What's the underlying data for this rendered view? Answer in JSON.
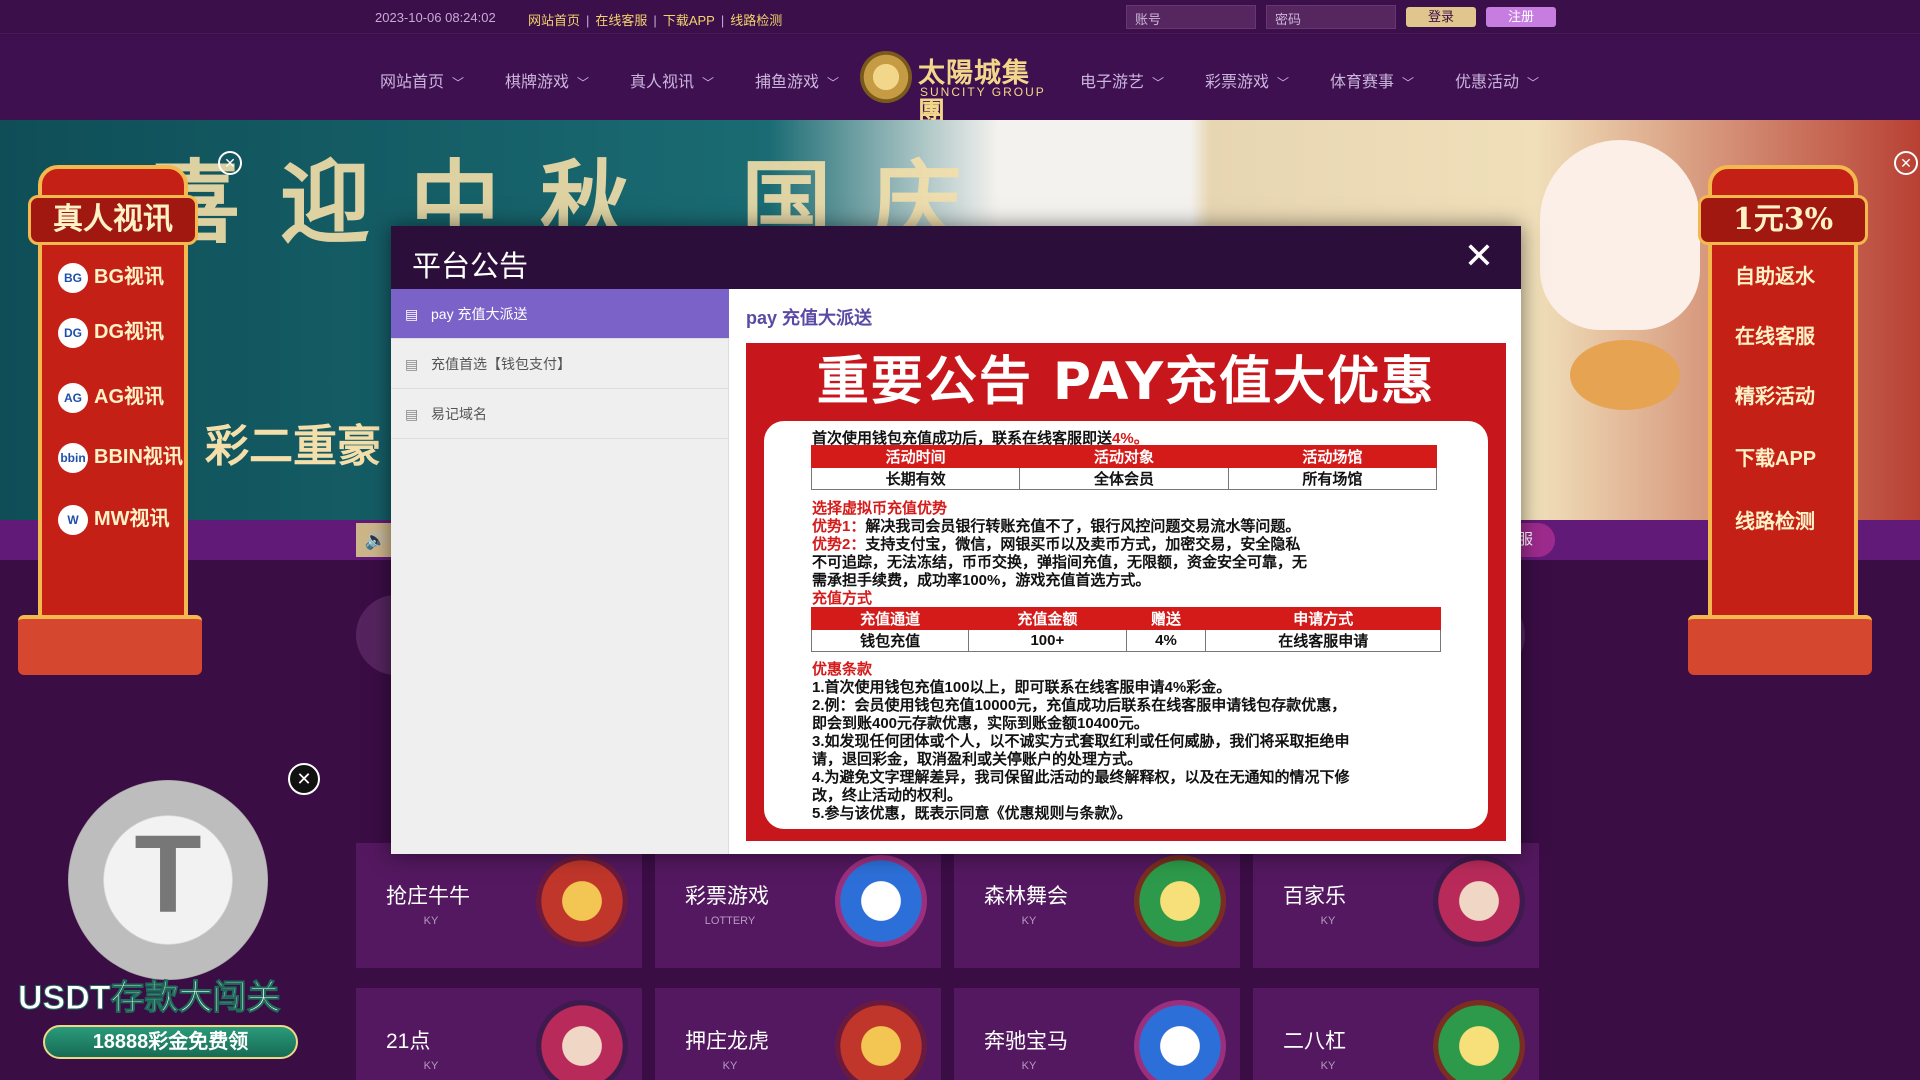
{
  "topbar": {
    "datetime": "2023-10-06 08:24:02",
    "links": [
      "网站首页",
      "在线客服",
      "下载APP",
      "线路检测"
    ],
    "account_placeholder": "账号",
    "password_placeholder": "密码",
    "login_label": "登录",
    "register_label": "注册"
  },
  "nav": {
    "left": [
      "网站首页",
      "棋牌游戏",
      "真人视讯",
      "捕鱼游戏"
    ],
    "right": [
      "电子游艺",
      "彩票游戏",
      "体育赛事",
      "优惠活动"
    ],
    "logo_cn": "太陽城集團",
    "logo_en": "SUNCITY GROUP"
  },
  "banner": {
    "title": "喜迎中秋 国庆",
    "subtitle": "彩二重豪"
  },
  "strip": {
    "service_tail": "服"
  },
  "left_float": {
    "header": "真人视讯",
    "items": [
      {
        "badge": "BG",
        "label": "BG视讯"
      },
      {
        "badge": "DG",
        "label": "DG视讯"
      },
      {
        "badge": "AG",
        "label": "AG视讯"
      },
      {
        "badge": "bbin",
        "label": "BBIN视讯"
      },
      {
        "badge": "W",
        "label": "MW视讯"
      }
    ]
  },
  "right_float": {
    "header": "1元3%",
    "items": [
      "自助返水",
      "在线客服",
      "精彩活动",
      "下载APP",
      "线路检测"
    ]
  },
  "usdt_promo": {
    "coin_text": "TETHER",
    "title": "USDT存款大闯关",
    "subtitle": "18888彩金免费领"
  },
  "games": [
    {
      "name": "抢庄牛牛",
      "tag": "KY",
      "icon": "抢庄牛牛"
    },
    {
      "name": "彩票游戏",
      "tag": "LOTTERY",
      "icon": "彩票游戏"
    },
    {
      "name": "森林舞会",
      "tag": "KY",
      "icon": "森林舞会"
    },
    {
      "name": "百家乐",
      "tag": "KY",
      "icon": "百家乐"
    },
    {
      "name": "21点",
      "tag": "KY",
      "icon": "21点"
    },
    {
      "name": "押庄龙虎",
      "tag": "KY",
      "icon": "押庄龙虎"
    },
    {
      "name": "奔驰宝马",
      "tag": "KY",
      "icon": "奔驰宝马"
    },
    {
      "name": "二八杠",
      "tag": "KY",
      "icon": "二八杠"
    }
  ],
  "modal": {
    "title": "平台公告",
    "close_icon": "close-icon",
    "list": [
      "pay 充值大派送",
      "充值首选【钱包支付】",
      "易记域名"
    ],
    "active_index": 0,
    "content_title": "pay 充值大派送",
    "poster": {
      "headline": "重要公告 PAY充值大优惠",
      "intro_prefix": "首次使用钱包充值成功后，联系在线客服即送",
      "intro_pct": "4%。",
      "table1": {
        "headers": [
          "活动时间",
          "活动对象",
          "活动场馆"
        ],
        "row": [
          "长期有效",
          "全体会员",
          "所有场馆"
        ]
      },
      "adv_title": "选择虚拟币充值优势",
      "adv1_label": "优势1：",
      "adv1": "解决我司会员银行转账充值不了，银行风控问题交易流水等问题。",
      "adv2_label": "优势2：",
      "adv2a": "支持支付宝，微信，网银买币以及卖币方式，加密交易，安全隐私",
      "adv2b": "不可追踪，无法冻结，币币交换，弹指间充值，无限额，资金安全可靠，无",
      "adv2c": "需承担手续费，成功率100%，游戏充值首选方式。",
      "method_title": "充值方式",
      "table2": {
        "headers": [
          "充值通道",
          "充值金额",
          "赠送",
          "申请方式"
        ],
        "row": [
          "钱包充值",
          "100+",
          "4%",
          "在线客服申请"
        ]
      },
      "terms_title": "优惠条款",
      "terms": [
        "1.首次使用钱包充值100以上，即可联系在线客服申请4%彩金。",
        "2.例：会员使用钱包充值10000元，充值成功后联系在线客服申请钱包存款优惠，",
        "即会到账400元存款优惠，实际到账金额10400元。",
        "3.如发现任何团体或个人，以不诚实方式套取红利或任何威胁，我们将采取拒绝申",
        "请，退回彩金，取消盈利或关停账户的处理方式。",
        "4.为避免文字理解差异，我司保留此活动的最终解释权，以及在无通知的情况下修",
        "改，终止活动的权利。",
        "5.参与该优惠，既表示同意《优惠规则与条款》。"
      ]
    }
  }
}
